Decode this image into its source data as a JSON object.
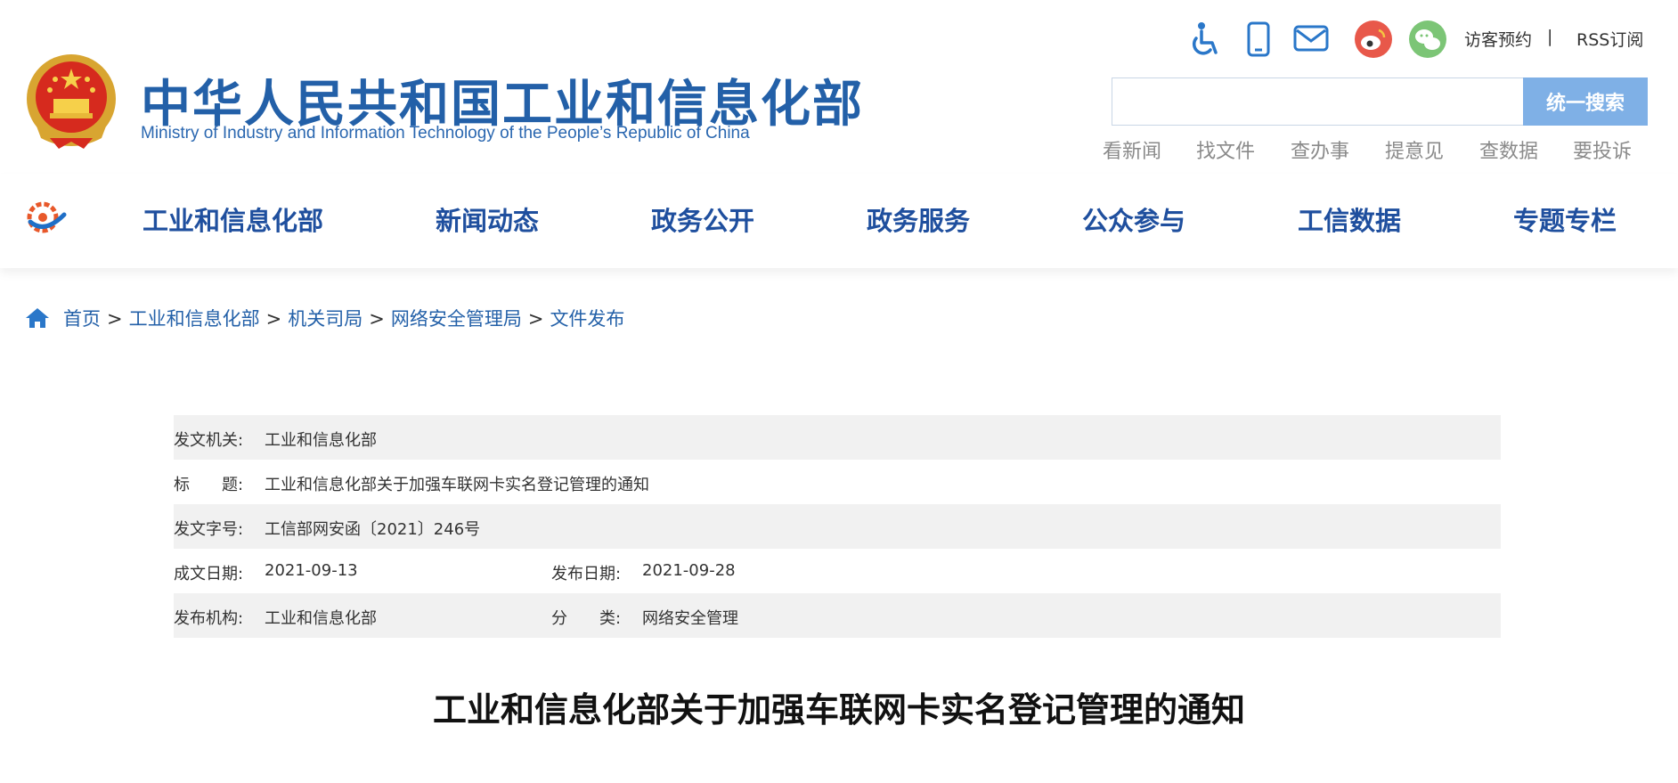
{
  "header": {
    "ministry_cn": "中华人民共和国工业和信息化部",
    "ministry_en": "Ministry of Industry and Information Technology of the People’s Republic of China",
    "visitor": "访客预约",
    "separator": "|",
    "rss": "RSS订阅",
    "search_button": "统一搜索",
    "search_placeholder": "",
    "quick_links": [
      "看新闻",
      "找文件",
      "查办事",
      "提意见",
      "查数据",
      "要投诉"
    ],
    "icons": [
      "accessibility-icon",
      "mobile-icon",
      "mail-icon",
      "weibo-icon",
      "wechat-icon"
    ]
  },
  "nav": {
    "items": [
      "工业和信息化部",
      "新闻动态",
      "政务公开",
      "政务服务",
      "公众参与",
      "工信数据",
      "专题专栏"
    ]
  },
  "breadcrumb": {
    "items": [
      "首页",
      "工业和信息化部",
      "机关司局",
      "网络安全管理局",
      "文件发布"
    ],
    "separator": ">"
  },
  "meta": {
    "issuer_label": "发文机关:",
    "issuer": "工业和信息化部",
    "title_label": "标　　题:",
    "title": "工业和信息化部关于加强车联网卡实名登记管理的通知",
    "doc_no_label": "发文字号:",
    "doc_no": "工信部网安函〔2021〕246号",
    "written_label": "成文日期:",
    "written": "2021-09-13",
    "published_label": "发布日期:",
    "published": "2021-09-28",
    "org_label": "发布机构:",
    "org": "工业和信息化部",
    "category_label": "分　　类:",
    "category": "网络安全管理"
  },
  "article": {
    "title": "工业和信息化部关于加强车联网卡实名登记管理的通知"
  },
  "colors": {
    "brand_blue": "#2360a8",
    "search_button": "#7fb0e6",
    "row_shade": "#f1f1f1"
  }
}
